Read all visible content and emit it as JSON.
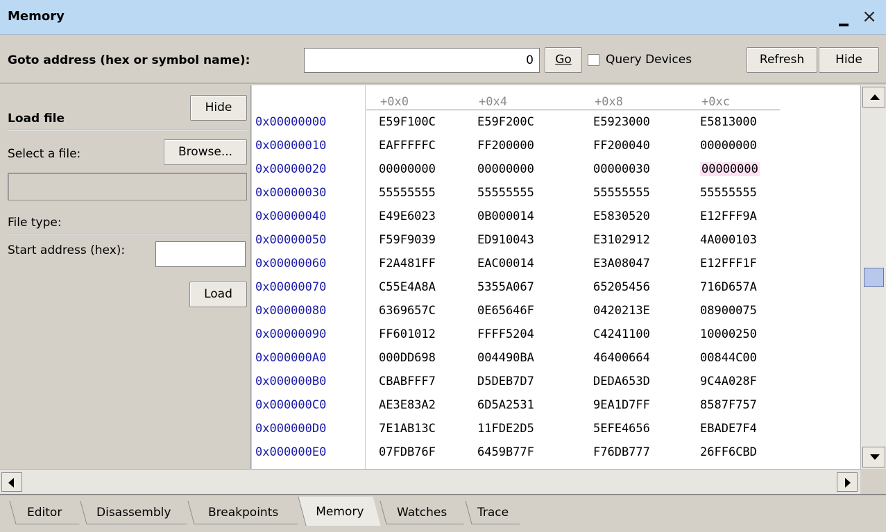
{
  "window": {
    "title": "Memory",
    "minimize": "_",
    "close": "×"
  },
  "toolbar": {
    "goto_label": "Goto address (hex or symbol name):",
    "goto_value": "0",
    "go_label": "Go",
    "query_devices_label": "Query Devices",
    "query_devices_checked": false,
    "refresh_label": "Refresh",
    "hide_label": "Hide"
  },
  "load_panel": {
    "title": "Load file",
    "hide_label": "Hide",
    "select_label": "Select a file:",
    "browse_label": "Browse...",
    "file_path": "",
    "file_type_label": "File type:",
    "start_label": "Start address (hex):",
    "start_value": "",
    "load_label": "Load"
  },
  "memory": {
    "columns": [
      "+0x0",
      "+0x4",
      "+0x8",
      "+0xc"
    ],
    "rows": [
      {
        "addr": "0x00000000",
        "cells": [
          "E59F100C",
          "E59F200C",
          "E5923000",
          "E5813000"
        ]
      },
      {
        "addr": "0x00000010",
        "cells": [
          "EAFFFFFC",
          "FF200000",
          "FF200040",
          "00000000"
        ]
      },
      {
        "addr": "0x00000020",
        "cells": [
          "00000000",
          "00000000",
          "00000030",
          "00000000"
        ]
      },
      {
        "addr": "0x00000030",
        "cells": [
          "55555555",
          "55555555",
          "55555555",
          "55555555"
        ]
      },
      {
        "addr": "0x00000040",
        "cells": [
          "E49E6023",
          "0B000014",
          "E5830520",
          "E12FFF9A"
        ]
      },
      {
        "addr": "0x00000050",
        "cells": [
          "F59F9039",
          "ED910043",
          "E3102912",
          "4A000103"
        ]
      },
      {
        "addr": "0x00000060",
        "cells": [
          "F2A481FF",
          "EAC00014",
          "E3A08047",
          "E12FFF1F"
        ]
      },
      {
        "addr": "0x00000070",
        "cells": [
          "C55E4A8A",
          "5355A067",
          "65205456",
          "716D657A"
        ]
      },
      {
        "addr": "0x00000080",
        "cells": [
          "6369657C",
          "0E65646F",
          "0420213E",
          "08900075"
        ]
      },
      {
        "addr": "0x00000090",
        "cells": [
          "FF601012",
          "FFFF5204",
          "C4241100",
          "10000250"
        ]
      },
      {
        "addr": "0x000000A0",
        "cells": [
          "000DD698",
          "004490BA",
          "46400664",
          "00844C00"
        ]
      },
      {
        "addr": "0x000000B0",
        "cells": [
          "CBABFFF7",
          "D5DEB7D7",
          "DEDA653D",
          "9C4A028F"
        ]
      },
      {
        "addr": "0x000000C0",
        "cells": [
          "AE3E83A2",
          "6D5A2531",
          "9EA1D7FF",
          "8587F757"
        ]
      },
      {
        "addr": "0x000000D0",
        "cells": [
          "7E1AB13C",
          "11FDE2D5",
          "5EFE4656",
          "EBADE7F4"
        ]
      },
      {
        "addr": "0x000000E0",
        "cells": [
          "07FDB76F",
          "6459B77F",
          "F76DB777",
          "26FF6CBD"
        ]
      }
    ],
    "highlighted_cell": {
      "row": 2,
      "col": 3,
      "color": "#fde0f4"
    },
    "address_color": "#1a1aaa"
  },
  "tabs": [
    {
      "label": "Editor",
      "active": false
    },
    {
      "label": "Disassembly",
      "active": false
    },
    {
      "label": "Breakpoints",
      "active": false
    },
    {
      "label": "Memory",
      "active": true
    },
    {
      "label": "Watches",
      "active": false
    },
    {
      "label": "Trace",
      "active": false
    }
  ]
}
